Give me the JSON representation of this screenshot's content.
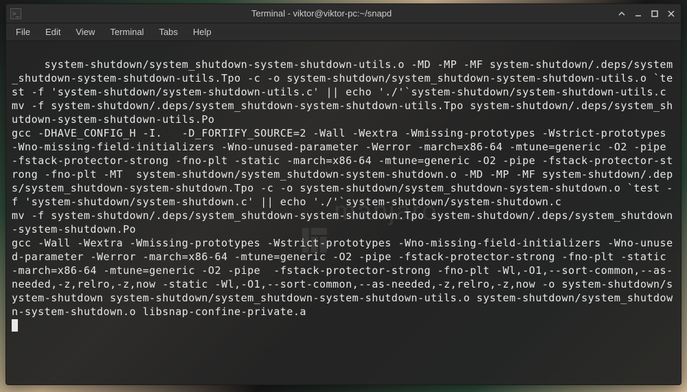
{
  "window": {
    "title": "Terminal - viktor@viktor-pc:~/snapd"
  },
  "menubar": {
    "items": [
      "File",
      "Edit",
      "View",
      "Terminal",
      "Tabs",
      "Help"
    ]
  },
  "watermark": "manjaro",
  "terminal": {
    "lines": [
      " system-shutdown/system_shutdown-system-shutdown-utils.o -MD -MP -MF system-shutdown/.deps/system_shutdown-system-shutdown-utils.Tpo -c -o system-shutdown/system_shutdown-system-shutdown-utils.o `test -f 'system-shutdown/system-shutdown-utils.c' || echo './'`system-shutdown/system-shutdown-utils.c",
      "mv -f system-shutdown/.deps/system_shutdown-system-shutdown-utils.Tpo system-shutdown/.deps/system_shutdown-system-shutdown-utils.Po",
      "gcc -DHAVE_CONFIG_H -I.   -D_FORTIFY_SOURCE=2 -Wall -Wextra -Wmissing-prototypes -Wstrict-prototypes -Wno-missing-field-initializers -Wno-unused-parameter -Werror -march=x86-64 -mtune=generic -O2 -pipe -fstack-protector-strong -fno-plt -static -march=x86-64 -mtune=generic -O2 -pipe -fstack-protector-strong -fno-plt -MT  system-shutdown/system_shutdown-system-shutdown.o -MD -MP -MF system-shutdown/.deps/system_shutdown-system-shutdown.Tpo -c -o system-shutdown/system_shutdown-system-shutdown.o `test -f 'system-shutdown/system-shutdown.c' || echo './'`system-shutdown/system-shutdown.c",
      "mv -f system-shutdown/.deps/system_shutdown-system-shutdown.Tpo system-shutdown/.deps/system_shutdown-system-shutdown.Po",
      "gcc -Wall -Wextra -Wmissing-prototypes -Wstrict-prototypes -Wno-missing-field-initializers -Wno-unused-parameter -Werror -march=x86-64 -mtune=generic -O2 -pipe -fstack-protector-strong -fno-plt -static -march=x86-64 -mtune=generic -O2 -pipe  -fstack-protector-strong -fno-plt -Wl,-O1,--sort-common,--as-needed,-z,relro,-z,now -static -Wl,-O1,--sort-common,--as-needed,-z,relro,-z,now -o system-shutdown/system-shutdown system-shutdown/system_shutdown-system-shutdown-utils.o system-shutdown/system_shutdown-system-shutdown.o libsnap-confine-private.a"
    ]
  }
}
